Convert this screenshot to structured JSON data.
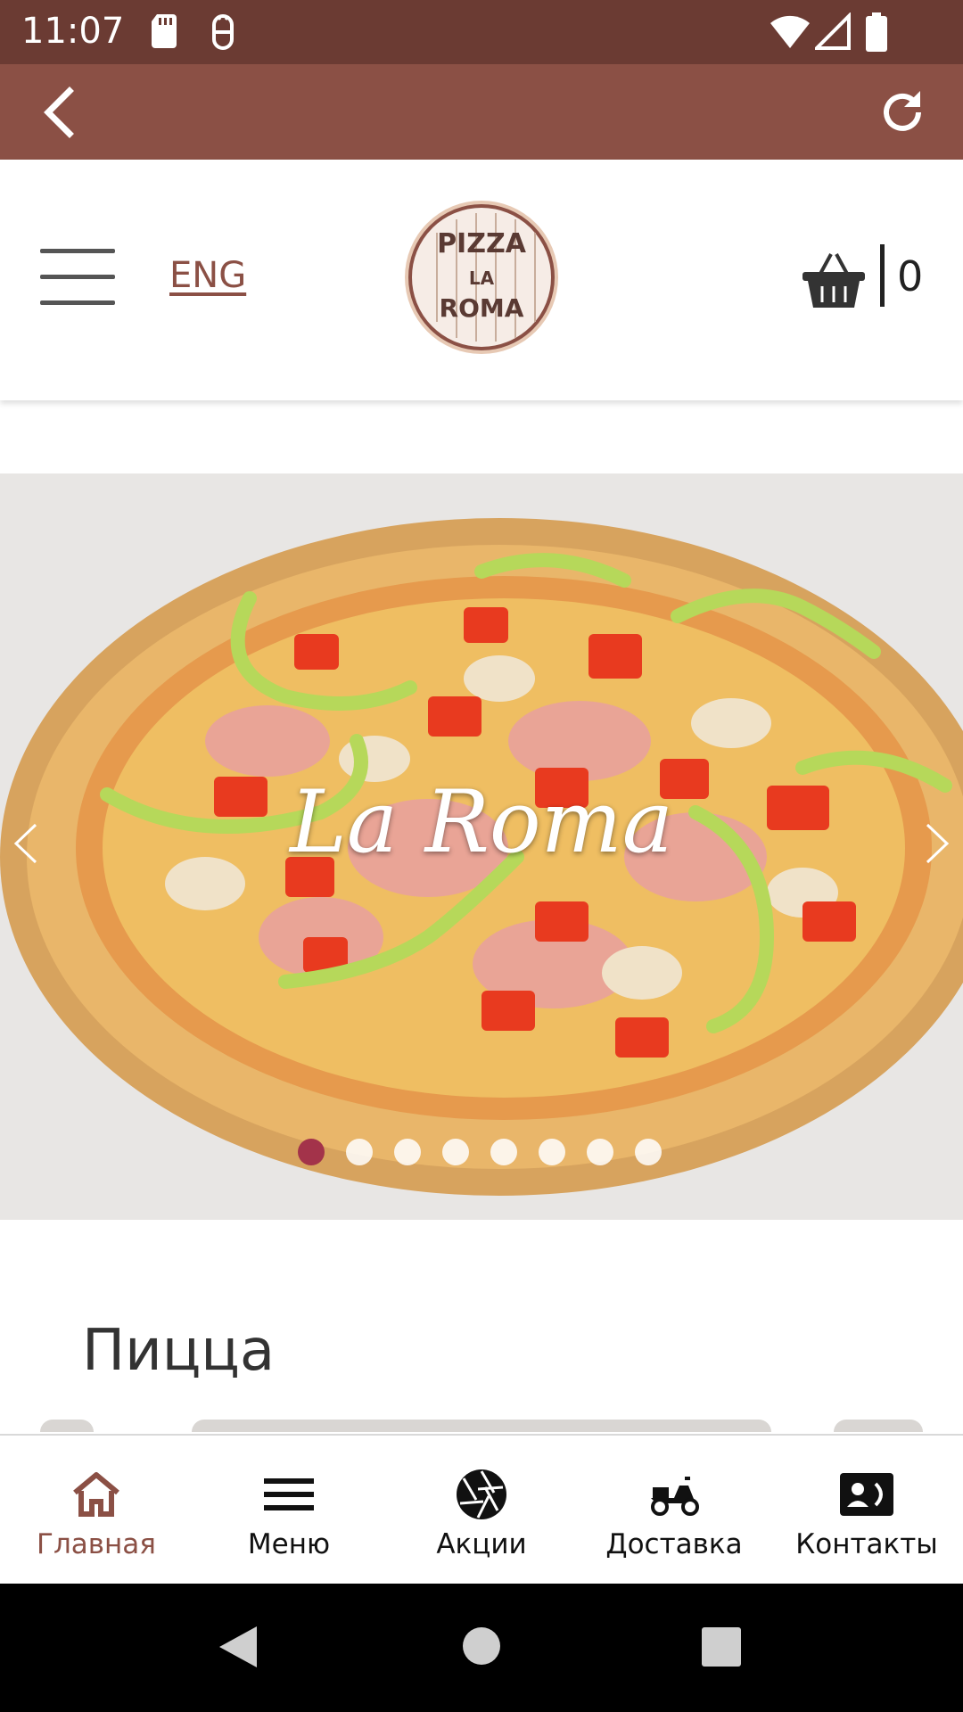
{
  "status_bar": {
    "time": "11:07",
    "icons": [
      "sd-card-icon",
      "android-debug-icon",
      "wifi-icon",
      "signal-icon",
      "battery-icon"
    ]
  },
  "app_bar": {
    "back_icon": "arrow-back-icon",
    "reload_icon": "reload-icon"
  },
  "header": {
    "menu_icon": "hamburger-icon",
    "language": "ENG",
    "logo_text": [
      "PIZZA",
      "LA",
      "ROMA"
    ],
    "cart_icon": "basket-icon",
    "cart_count": "0"
  },
  "slider": {
    "caption": "La Roma",
    "slide_count": 8,
    "active_index": 0,
    "prev_icon": "chevron-left-icon",
    "next_icon": "chevron-right-icon"
  },
  "section": {
    "title": "Пицца"
  },
  "bottom_nav": {
    "items": [
      {
        "label": "Главная",
        "icon": "home-icon",
        "active": true
      },
      {
        "label": "Меню",
        "icon": "menu-lines-icon",
        "active": false
      },
      {
        "label": "Акции",
        "icon": "aperture-icon",
        "active": false
      },
      {
        "label": "Доставка",
        "icon": "scooter-icon",
        "active": false
      },
      {
        "label": "Контакты",
        "icon": "contact-card-icon",
        "active": false
      }
    ]
  },
  "system_nav": {
    "icons": [
      "back-triangle-icon",
      "home-circle-icon",
      "recents-square-icon"
    ]
  },
  "colors": {
    "status_bar": "#6b3b33",
    "app_bar": "#8b5045",
    "accent": "#8b5045",
    "active_dot": "#a3334a"
  }
}
